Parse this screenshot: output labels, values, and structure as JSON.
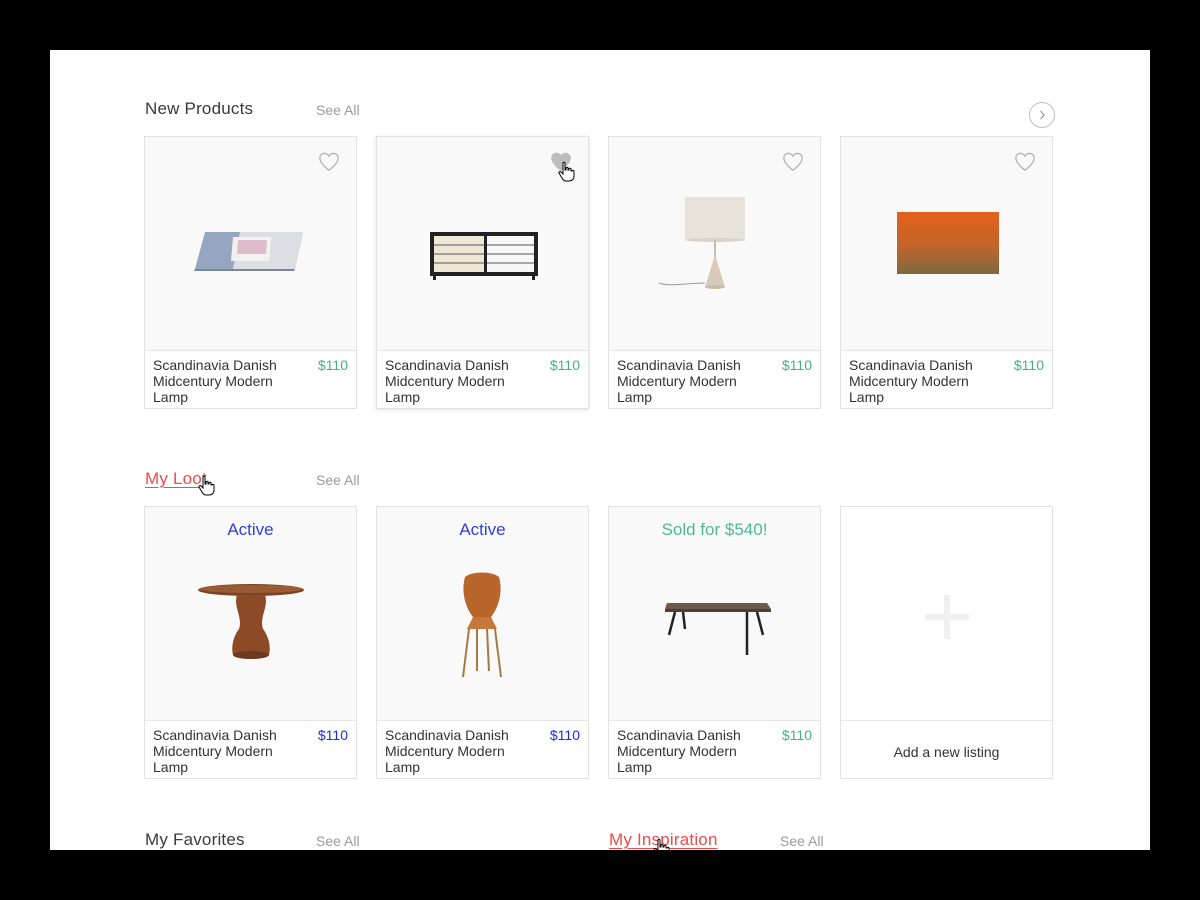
{
  "sections": {
    "new_products": {
      "title": "New Products",
      "see_all": "See All",
      "items": [
        {
          "name": "Scandinavia Danish Midcentury Modern Lamp",
          "price": "$110"
        },
        {
          "name": "Scandinavia Danish Midcentury Modern Lamp",
          "price": "$110"
        },
        {
          "name": "Scandinavia Danish Midcentury Modern Lamp",
          "price": "$110"
        },
        {
          "name": "Scandinavia Danish Midcentury Modern Lamp",
          "price": "$110"
        }
      ]
    },
    "my_loot": {
      "title": "My Loot",
      "see_all": "See All",
      "items": [
        {
          "status": "Active",
          "name": "Scandinavia Danish Midcentury Modern Lamp",
          "price": "$110"
        },
        {
          "status": "Active",
          "name": "Scandinavia Danish Midcentury Modern Lamp",
          "price": "$110"
        },
        {
          "status": "Sold for $540!",
          "name": "Scandinavia Danish Midcentury Modern Lamp",
          "price": "$110"
        }
      ],
      "add_listing_label": "Add a new listing"
    },
    "my_favorites": {
      "title": "My Favorites",
      "see_all": "See All"
    },
    "my_inspiration": {
      "title": "My Inspiration",
      "see_all": "See All"
    }
  },
  "icons": {
    "heart": "heart-icon",
    "next": "chevron-right-icon",
    "add": "plus-icon",
    "cursor": "hand-cursor-icon"
  },
  "colors": {
    "price_green": "#43b08a",
    "price_blue": "#1a2be8",
    "status_active": "#2f3fe0",
    "status_sold": "#4fb796",
    "link_red": "#ef4b4b"
  }
}
